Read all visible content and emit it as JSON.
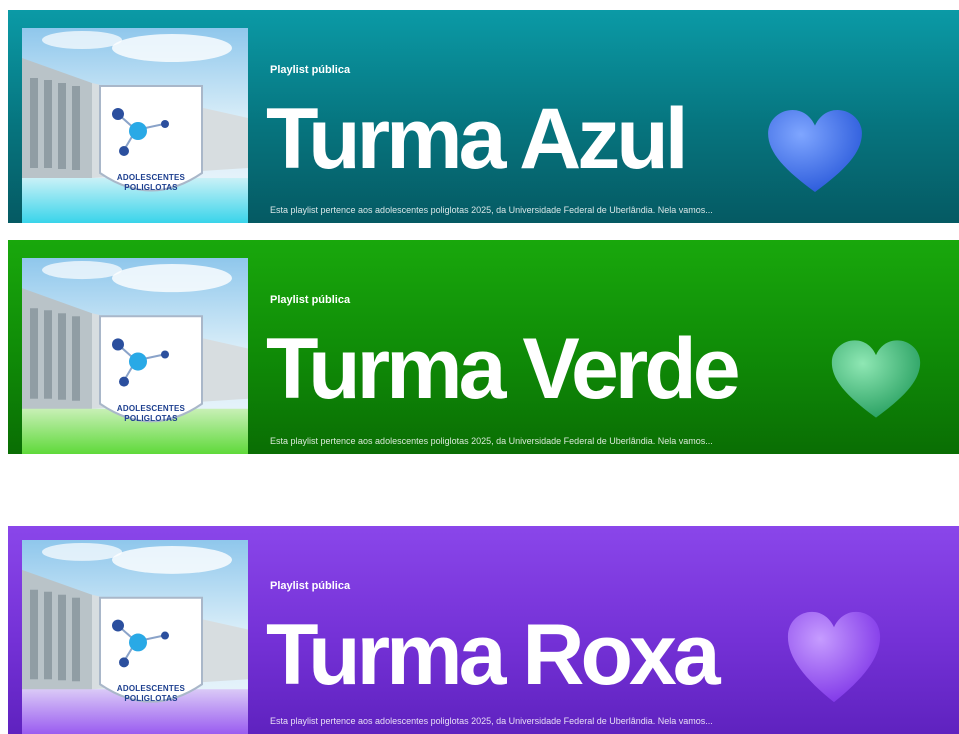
{
  "cover": {
    "badge_line1": "ADOLESCENTES",
    "badge_line2": "POLIGLOTAS"
  },
  "playlists": [
    {
      "kind": "Playlist pública",
      "title": "Turma Azul",
      "description": "Esta playlist pertence aos adolescentes poliglotas 2025, da Universidade Federal de Uberlândia. Nela vamos...",
      "color": "#06747e",
      "heart_icon": "blue-heart-icon",
      "heart_color": "#3b6ff0"
    },
    {
      "kind": "Playlist pública",
      "title": "Turma Verde",
      "description": "Esta playlist pertence aos adolescentes poliglotas 2025, da Universidade Federal de Uberlândia. Nela vamos...",
      "color": "#0f8a07",
      "heart_icon": "green-heart-icon",
      "heart_color": "#3cc276"
    },
    {
      "kind": "Playlist pública",
      "title": "Turma Roxa",
      "description": "Esta playlist pertence aos adolescentes poliglotas 2025, da Universidade Federal de Uberlândia. Nela vamos...",
      "color": "#7431d6",
      "heart_icon": "purple-heart-icon",
      "heart_color": "#9a52f0"
    }
  ]
}
